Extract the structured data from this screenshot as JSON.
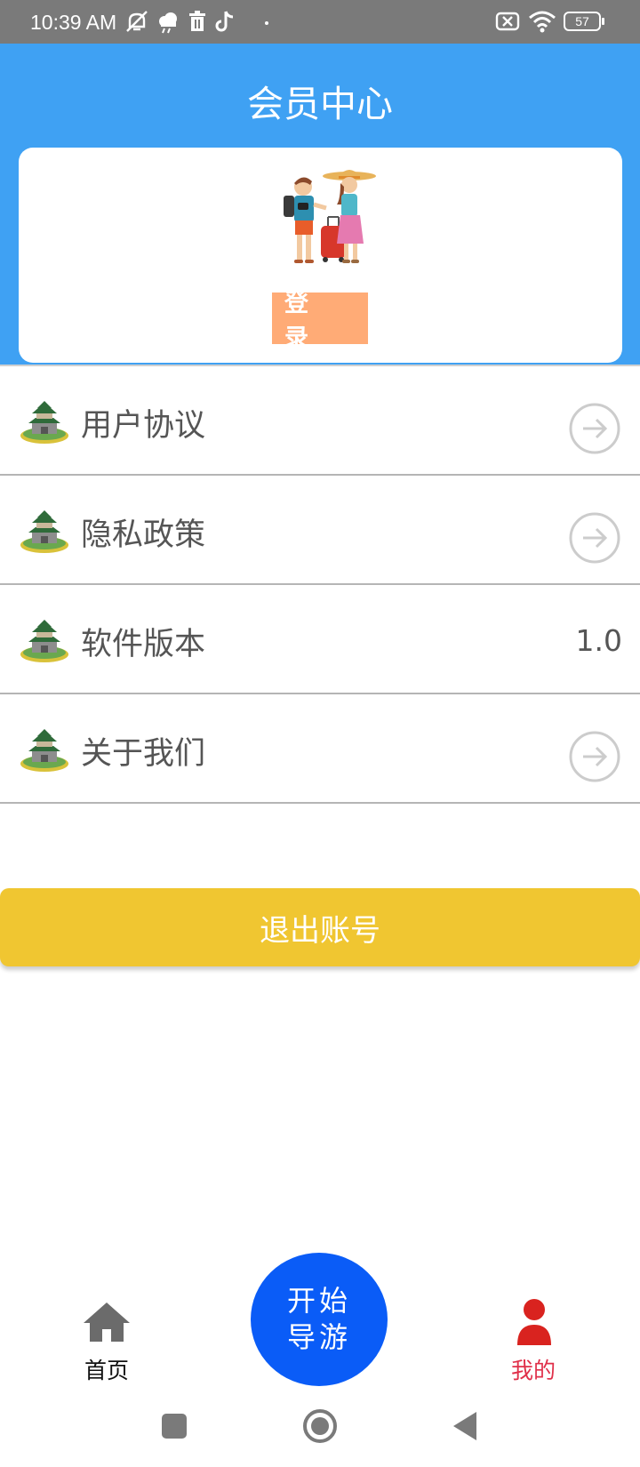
{
  "status_bar": {
    "time": "10:39 AM",
    "battery": "57",
    "icons": [
      "alarm-off-icon",
      "cloud-icon",
      "trash-icon",
      "tiktok-icon",
      "dot-icon",
      "sim-off-icon",
      "wifi-icon",
      "battery-icon"
    ]
  },
  "header": {
    "title": "会员中心",
    "background_color": "#3fa1f3"
  },
  "member_card": {
    "login_label": "登 录",
    "login_color": "#ffab76"
  },
  "menu": {
    "items": [
      {
        "label": "用户协议",
        "action": "arrow-right-icon"
      },
      {
        "label": "隐私政策",
        "action": "arrow-right-icon"
      },
      {
        "label": "软件版本",
        "value": "1.0"
      },
      {
        "label": "关于我们",
        "action": "arrow-right-icon"
      }
    ]
  },
  "logout": {
    "label": "退出账号",
    "color": "#f0c631"
  },
  "bottom_nav": {
    "home_label": "首页",
    "start_line1": "开始",
    "start_line2": "导游",
    "mine_label": "我的",
    "active_color": "#e0304a",
    "start_color": "#0a5cf7"
  }
}
